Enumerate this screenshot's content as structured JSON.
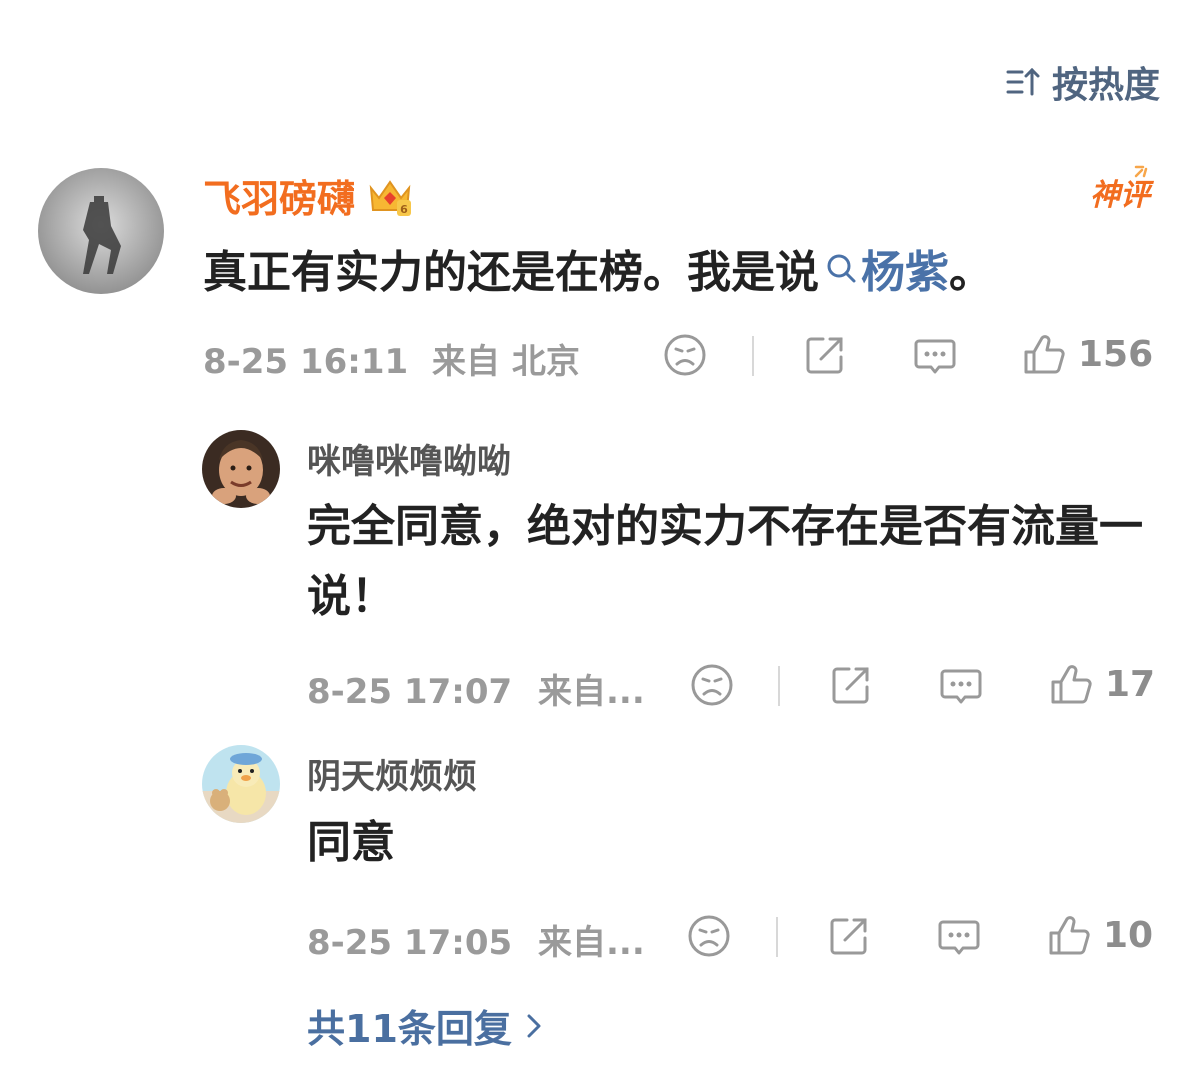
{
  "header": {
    "sort_label": "按热度",
    "sort_icon": "sort-icon"
  },
  "comment": {
    "username": "飞羽磅礴",
    "badge": "神评",
    "text_before": "真正有实力的还是在榜。我是说",
    "topic": "杨紫",
    "text_after": " 。",
    "timestamp": "8-25 16:11",
    "location": "来自 北京",
    "likes": "156"
  },
  "replies": [
    {
      "username": "咪噜咪噜呦呦",
      "text": "完全同意，绝对的实力不存在是否有流量一说！",
      "timestamp": "8-25 17:07",
      "location": "来自...",
      "likes": "17"
    },
    {
      "username": "阴天烦烦烦",
      "text": "同意",
      "timestamp": "8-25 17:05",
      "location": "来自...",
      "likes": "10"
    }
  ],
  "footer": {
    "more_replies": "共11条回复"
  },
  "colors": {
    "orange": "#f26d1f",
    "link_blue": "#4a72a8",
    "meta_gray": "#9a9a9a"
  }
}
